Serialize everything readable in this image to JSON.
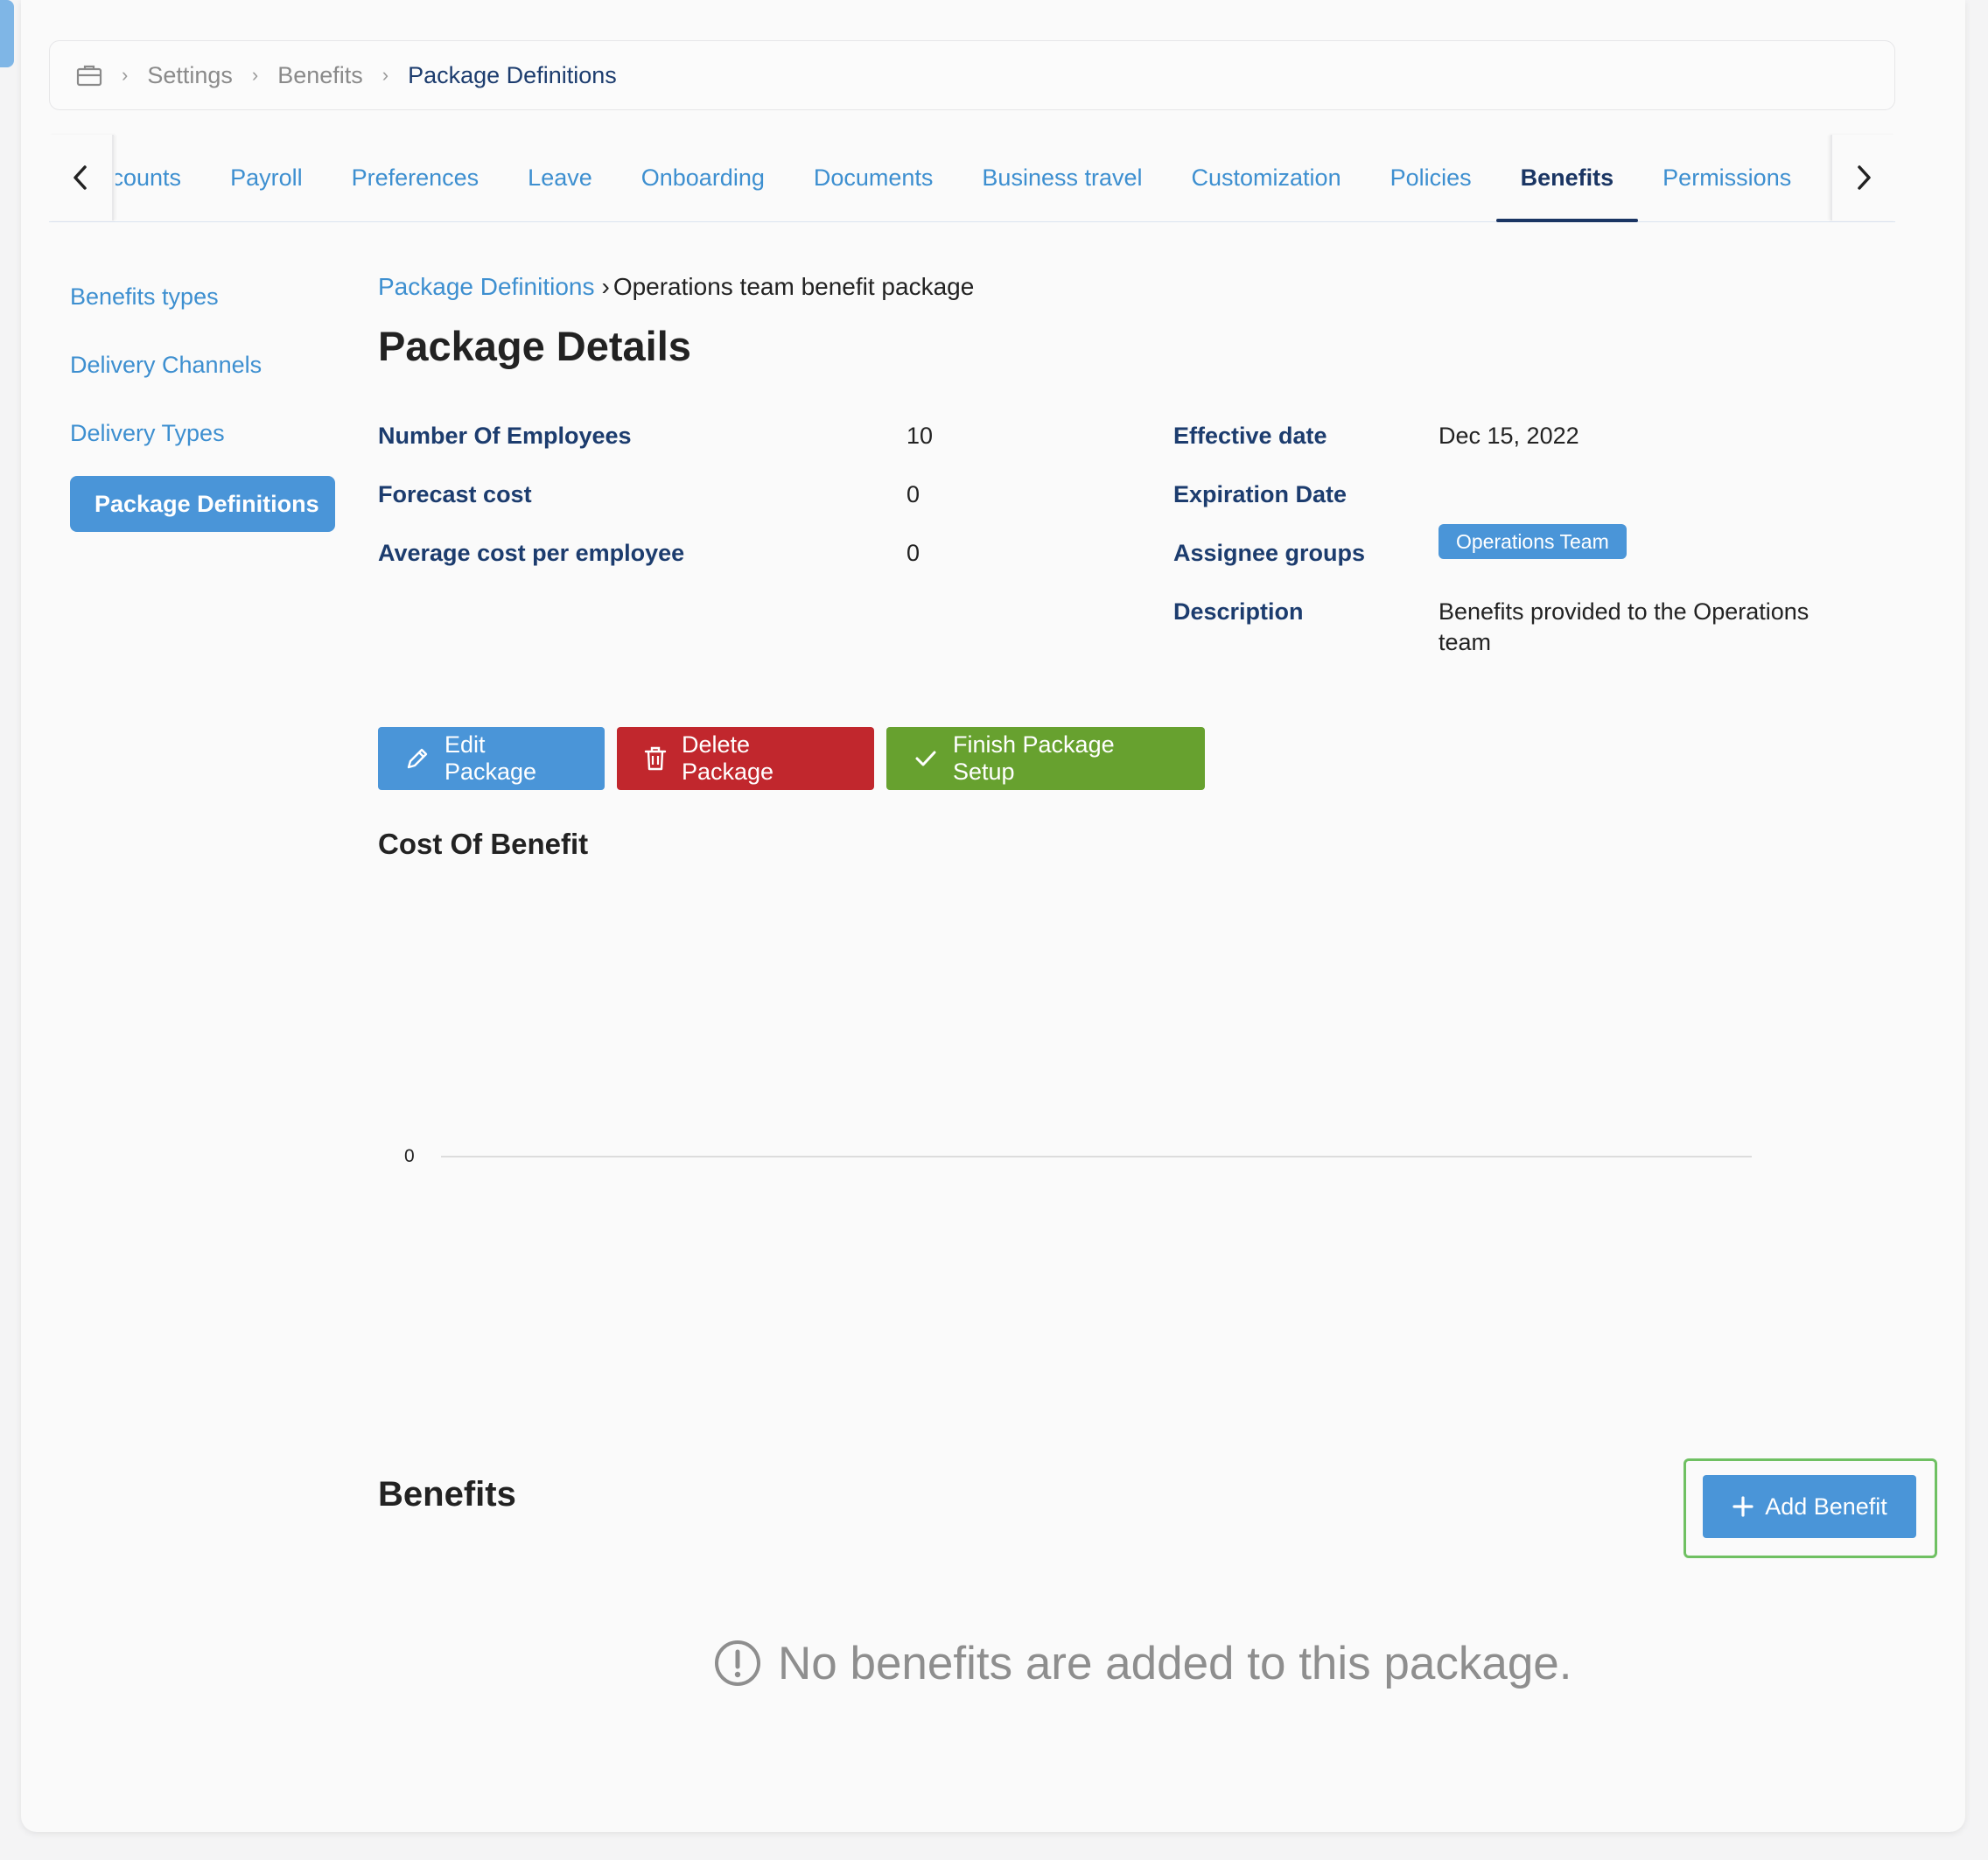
{
  "breadcrumb": {
    "icon": "briefcase-icon",
    "items": [
      "Settings",
      "Benefits",
      "Package Definitions"
    ]
  },
  "tabs": [
    "ccounts",
    "Payroll",
    "Preferences",
    "Leave",
    "Onboarding",
    "Documents",
    "Business travel",
    "Customization",
    "Policies",
    "Benefits",
    "Permissions"
  ],
  "active_tab": "Benefits",
  "sidebar": {
    "items": [
      {
        "label": "Benefits types"
      },
      {
        "label": "Delivery Channels"
      },
      {
        "label": "Delivery Types"
      },
      {
        "label": "Package Definitions",
        "active": true
      }
    ]
  },
  "sub_breadcrumb": {
    "link": "Package Definitions",
    "current": "Operations team benefit package"
  },
  "page_title": "Package Details",
  "details_left": [
    {
      "label": "Number Of Employees",
      "value": "10"
    },
    {
      "label": "Forecast cost",
      "value": "0"
    },
    {
      "label": "Average cost per employee",
      "value": "0"
    }
  ],
  "details_right": {
    "effective_label": "Effective date",
    "effective_value": "Dec 15, 2022",
    "expiration_label": "Expiration Date",
    "expiration_value": "",
    "assignee_label": "Assignee groups",
    "assignee_badge": "Operations Team",
    "description_label": "Description",
    "description_value": "Benefits provided to the Operations team"
  },
  "buttons": {
    "edit": "Edit Package",
    "delete": "Delete Package",
    "finish": "Finish Package Setup"
  },
  "cost_section_title": "Cost Of Benefit",
  "chart_data": {
    "type": "bar",
    "categories": [],
    "values": [],
    "title": "",
    "y_tick_labels": [
      "0"
    ]
  },
  "benefits_section": {
    "title": "Benefits",
    "add_button": "Add Benefit",
    "empty_message": "No benefits are added to this package."
  },
  "colors": {
    "primary": "#4a95d8",
    "danger": "#c1272d",
    "success": "#67a12f",
    "navy": "#1c3c6e",
    "highlight": "#6fc062"
  }
}
